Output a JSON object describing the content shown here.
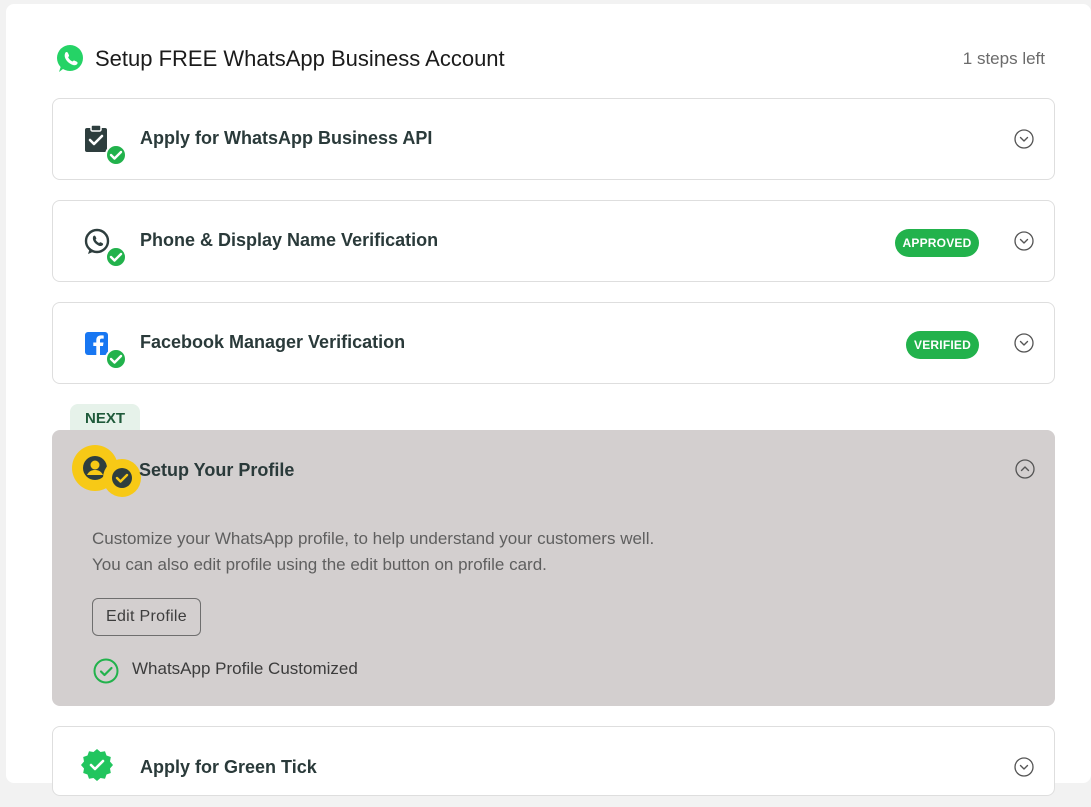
{
  "header": {
    "logo_icon": "whatsapp-logo-icon",
    "title": "Setup FREE WhatsApp Business Account",
    "steps_left": "1 steps left"
  },
  "steps": [
    {
      "label": "Apply for WhatsApp Business API",
      "icon": "clipboard-check-icon",
      "status": "completed"
    },
    {
      "label": "Phone & Display Name Verification",
      "icon": "whatsapp-phone-icon",
      "status": "completed",
      "badge": "APPROVED"
    },
    {
      "label": "Facebook Manager Verification",
      "icon": "facebook-icon",
      "status": "completed",
      "badge": "VERIFIED"
    }
  ],
  "next_tag": "NEXT",
  "active_step": {
    "label": "Setup Your Profile",
    "icon": "profile-icon",
    "description_line1": "Customize your WhatsApp profile, to help understand your customers well.",
    "description_line2": "You can also edit profile using the edit button on profile card.",
    "edit_button": "Edit Profile",
    "completed_item": "WhatsApp Profile Customized"
  },
  "last_step": {
    "label": "Apply for Green Tick",
    "icon": "verified-badge-icon"
  },
  "colors": {
    "brand_green": "#22b24c",
    "active_bg": "#d3cfcf",
    "accent_yellow": "#f7c916",
    "next_tag_bg": "#e6f2ea"
  }
}
